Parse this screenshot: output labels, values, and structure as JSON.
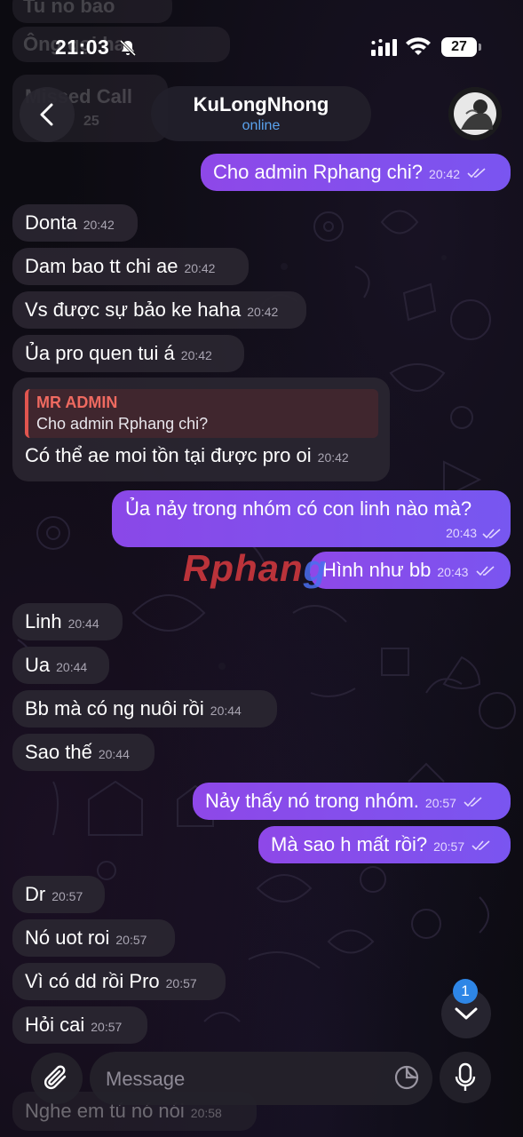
{
  "status_bar": {
    "time": "21:03",
    "battery": "27"
  },
  "header": {
    "back_label": "Back",
    "name": "KuLongNhong",
    "status": "online"
  },
  "ghost_messages": [
    "Tu no bao",
    "Ông gọi ha",
    "Missed Call",
    "25"
  ],
  "watermark": {
    "part1": "Rphan",
    "part2": "g"
  },
  "messages": [
    {
      "dir": "out",
      "text": "Cho admin Rphang chi?",
      "time": "20:42"
    },
    {
      "dir": "in",
      "text": "Donta",
      "time": "20:42"
    },
    {
      "dir": "in",
      "text": "Dam bao tt chi ae",
      "time": "20:42"
    },
    {
      "dir": "in",
      "text": "Vs được sự bảo ke haha",
      "time": "20:42"
    },
    {
      "dir": "in",
      "text": "Ủa pro quen tui á",
      "time": "20:42"
    },
    {
      "dir": "in",
      "text": "Có thể ae moi tồn tại được pro oi",
      "time": "20:42",
      "reply": {
        "name": "MR ADMIN",
        "text": "Cho admin Rphang chi?"
      }
    },
    {
      "dir": "out",
      "text": "Ủa nảy trong nhóm có con linh nào mà?",
      "time": "20:43"
    },
    {
      "dir": "out",
      "text": "Hình như bb",
      "time": "20:43"
    },
    {
      "dir": "in",
      "text": "Linh",
      "time": "20:44"
    },
    {
      "dir": "in",
      "text": "Ua",
      "time": "20:44"
    },
    {
      "dir": "in",
      "text": "Bb mà có ng nuôi rồi",
      "time": "20:44"
    },
    {
      "dir": "in",
      "text": "Sao thế",
      "time": "20:44"
    },
    {
      "dir": "out",
      "text": "Nảy thấy nó trong nhóm.",
      "time": "20:57"
    },
    {
      "dir": "out",
      "text": "Mà sao h mất rồi?",
      "time": "20:57"
    },
    {
      "dir": "in",
      "text": "Dr",
      "time": "20:57"
    },
    {
      "dir": "in",
      "text": "Nó uot roi",
      "time": "20:57"
    },
    {
      "dir": "in",
      "text": "Vì có dd rồi Pro",
      "time": "20:57"
    },
    {
      "dir": "in",
      "text": "Hỏi cai",
      "time": "20:57"
    },
    {
      "dir": "in",
      "text": "Nghe em tú nó nói",
      "time": "20:58"
    }
  ],
  "scroll": {
    "unread": "1"
  },
  "composer": {
    "placeholder": "Message"
  }
}
